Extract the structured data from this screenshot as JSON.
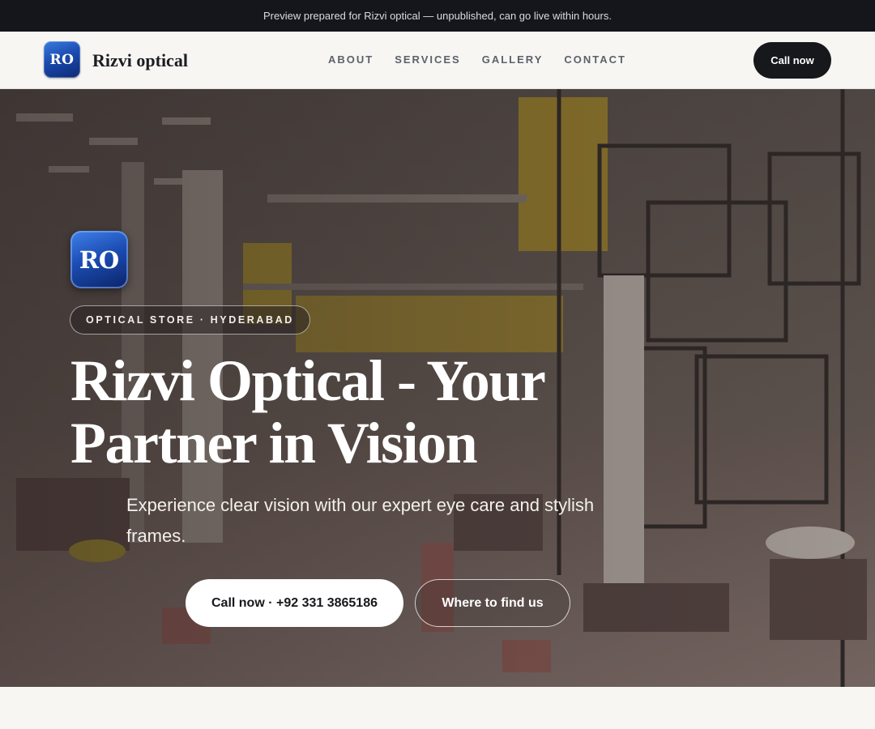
{
  "preview_bar": {
    "text": "Preview prepared for Rizvi optical — unpublished, can go live within hours."
  },
  "nav": {
    "logo_text": "RO",
    "brand_name": "Rizvi optical",
    "links": [
      "ABOUT",
      "SERVICES",
      "GALLERY",
      "CONTACT"
    ],
    "cta_label": "Call now"
  },
  "hero": {
    "logo_text": "RO",
    "tag": "OPTICAL STORE · HYDERABAD",
    "title_line1": "Rizvi Optical - Your",
    "title_line2": "Partner in Vision",
    "subtitle": "Experience clear vision with our expert eye care and stylish frames.",
    "primary_button": "Call now · +92 331 3865186",
    "secondary_button": "Where to find us"
  },
  "colors": {
    "preview_bar_bg": "#14161b",
    "nav_bg": "#f7f6f3",
    "cta_bg": "#17181c",
    "logo_blue": "#1b4bb0"
  }
}
